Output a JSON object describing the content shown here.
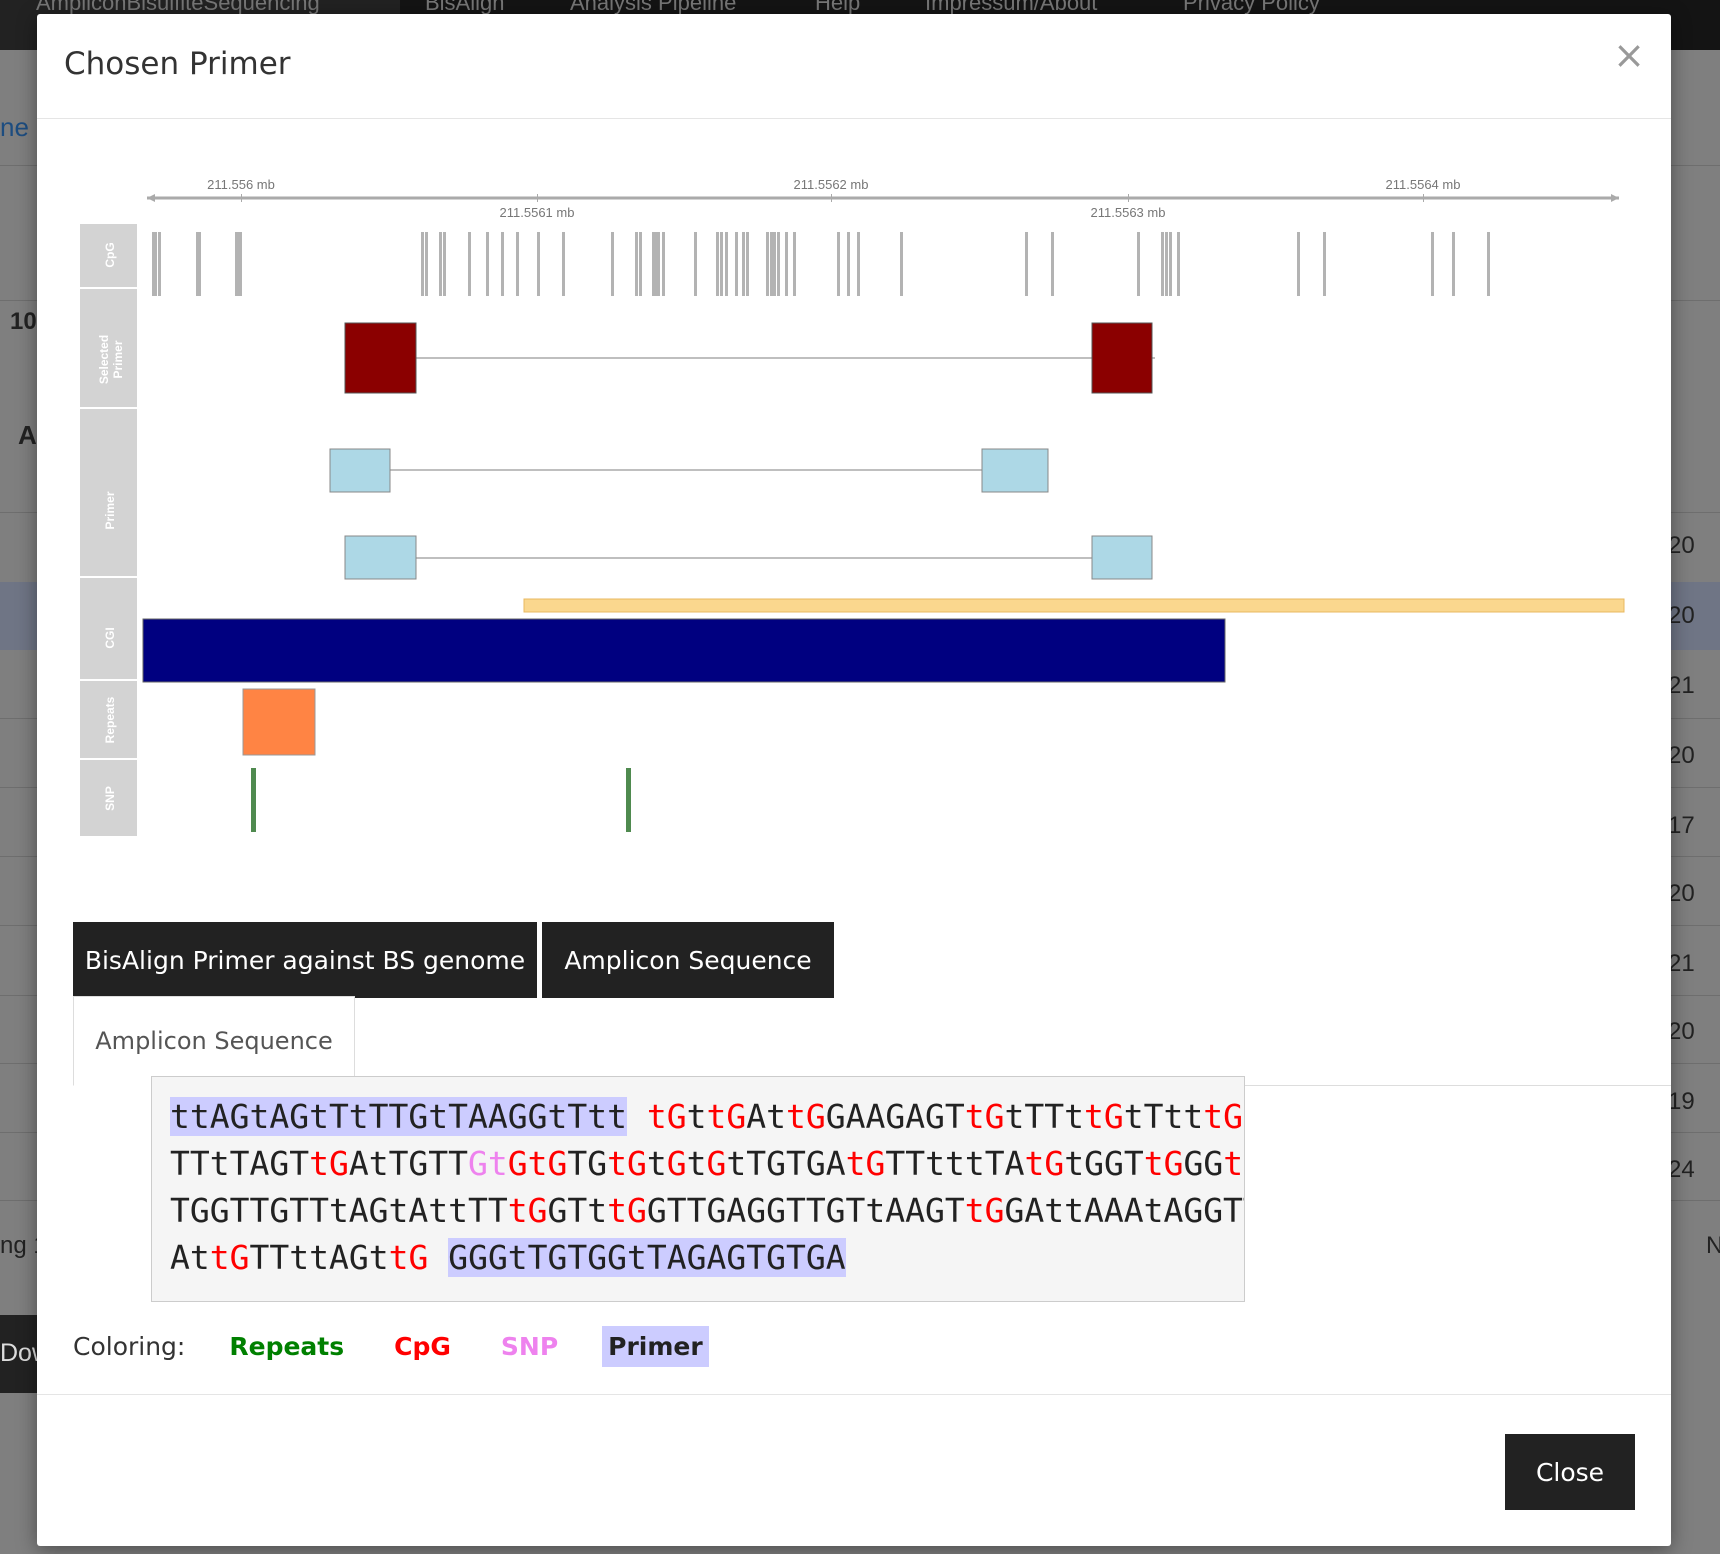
{
  "background": {
    "nav_links": [
      "AmpliconBisulfiteSequencing",
      "BisAlign",
      "Analysis Pipeline",
      "Help",
      "Impressum/About",
      "Privacy Policy"
    ],
    "left_fragments": [
      "ne",
      "10",
      "A",
      "ng 1",
      "Dow"
    ],
    "right_fragments": [
      "20",
      "20",
      "21",
      "20",
      "17",
      "20",
      "21",
      "20",
      "19",
      "24",
      "N"
    ]
  },
  "modal": {
    "title": "Chosen Primer",
    "close_x": "×",
    "close_button": "Close"
  },
  "genome_browser": {
    "axis_labels_top": [
      "211.556 mb",
      "211.5562 mb",
      "211.5564 mb"
    ],
    "axis_labels_bottom": [
      "211.5561 mb",
      "211.5563 mb"
    ],
    "track_labels": [
      "CpG",
      "Selected Primer",
      "Primer",
      "CGI",
      "Repeats",
      "SNP"
    ],
    "colors": {
      "cpg": "#b3b3b3",
      "selected_primer": "#8b0000",
      "primer": "#add8e6",
      "amplicon": "#fad78e",
      "cgi": "#000080",
      "repeats": "#ff8444",
      "snp": "#4f8a4f",
      "track_label_bg": "#d3d3d3"
    }
  },
  "buttons": {
    "bisalign": "BisAlign Primer against BS genome",
    "amplicon": "Amplicon Sequence"
  },
  "tab": {
    "label": "Amplicon Sequence"
  },
  "sequence_lines": [
    [
      {
        "t": "ttAGtAGtTtTTGtTAAGGtTtt",
        "c": "primer"
      },
      {
        "t": " ",
        "c": ""
      },
      {
        "t": "tG",
        "c": "cpg"
      },
      {
        "t": "t",
        "c": ""
      },
      {
        "t": "tG",
        "c": "cpg"
      },
      {
        "t": "At",
        "c": ""
      },
      {
        "t": "tG",
        "c": "cpg"
      },
      {
        "t": "GAAGAGT",
        "c": ""
      },
      {
        "t": "tG",
        "c": "cpg"
      },
      {
        "t": "tTTt",
        "c": ""
      },
      {
        "t": "tG",
        "c": "cpg"
      },
      {
        "t": "tTtt",
        "c": ""
      },
      {
        "t": "tG",
        "c": "cpg"
      },
      {
        "t": "t",
        "c": ""
      }
    ],
    [
      {
        "t": "TTtTAGT",
        "c": ""
      },
      {
        "t": "tG",
        "c": "cpg"
      },
      {
        "t": "AtTGTT",
        "c": ""
      },
      {
        "t": "Gt",
        "c": "snp"
      },
      {
        "t": "Gt",
        "c": "cpg"
      },
      {
        "t": "G",
        "c": "cpg"
      },
      {
        "t": "TG",
        "c": ""
      },
      {
        "t": "tG",
        "c": "cpg"
      },
      {
        "t": "t",
        "c": ""
      },
      {
        "t": "G",
        "c": "cpg"
      },
      {
        "t": "t",
        "c": ""
      },
      {
        "t": "G",
        "c": "cpg"
      },
      {
        "t": "tTGTGA",
        "c": ""
      },
      {
        "t": "tG",
        "c": "cpg"
      },
      {
        "t": "TTtttTA",
        "c": ""
      },
      {
        "t": "tG",
        "c": "cpg"
      },
      {
        "t": "tGGT",
        "c": ""
      },
      {
        "t": "tG",
        "c": "cpg"
      },
      {
        "t": "GG",
        "c": ""
      },
      {
        "t": "tG",
        "c": "cpg"
      }
    ],
    [
      {
        "t": "TGGTTGTTtAGtAttTT",
        "c": ""
      },
      {
        "t": "tG",
        "c": "cpg"
      },
      {
        "t": "GTt",
        "c": ""
      },
      {
        "t": "tG",
        "c": "cpg"
      },
      {
        "t": "GTTGAGGTTGTtAAGT",
        "c": ""
      },
      {
        "t": "tG",
        "c": "cpg"
      },
      {
        "t": "GAttAAAtAGGTT",
        "c": ""
      }
    ],
    [
      {
        "t": "At",
        "c": ""
      },
      {
        "t": "tG",
        "c": "cpg"
      },
      {
        "t": "TTttAGt",
        "c": ""
      },
      {
        "t": "tG",
        "c": "cpg"
      },
      {
        "t": " ",
        "c": ""
      },
      {
        "t": "GGGtTGTGGtTAGAGTGTGA",
        "c": "primer"
      }
    ]
  ],
  "legend": {
    "label": "Coloring:",
    "items": [
      {
        "text": "Repeats",
        "color": "#008000",
        "bg": ""
      },
      {
        "text": "CpG",
        "color": "#ff0000",
        "bg": ""
      },
      {
        "text": "SNP",
        "color": "#ee82ee",
        "bg": ""
      },
      {
        "text": "Primer",
        "color": "#222222",
        "bg": "#ccccff"
      }
    ]
  }
}
